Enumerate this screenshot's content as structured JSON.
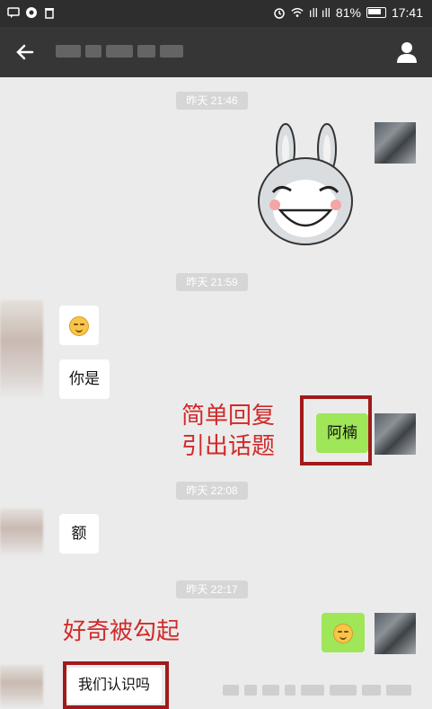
{
  "status_bar": {
    "signal": "ıll ıll",
    "battery": "81%",
    "time": "17:41"
  },
  "header": {
    "back_icon": "arrow-left-icon",
    "contact_name_blurred": true,
    "profile_icon": "person-icon"
  },
  "messages": {
    "ts1": "昨天 21:46",
    "ts2": "昨天 21:59",
    "ts3": "昨天 22:08",
    "ts4": "昨天 22:17",
    "msg_nishi": "你是",
    "msg_anan": "阿楠",
    "msg_e": "额",
    "msg_women": "我们认识吗"
  },
  "annotations": {
    "note1_line1": "简单回复",
    "note1_line2": "引出话题",
    "note2": "好奇被勾起"
  },
  "colors": {
    "header_bg": "#363636",
    "chat_bg": "#ebebeb",
    "bubble_green": "#9fe658",
    "annotation_red": "#d12a2a"
  }
}
